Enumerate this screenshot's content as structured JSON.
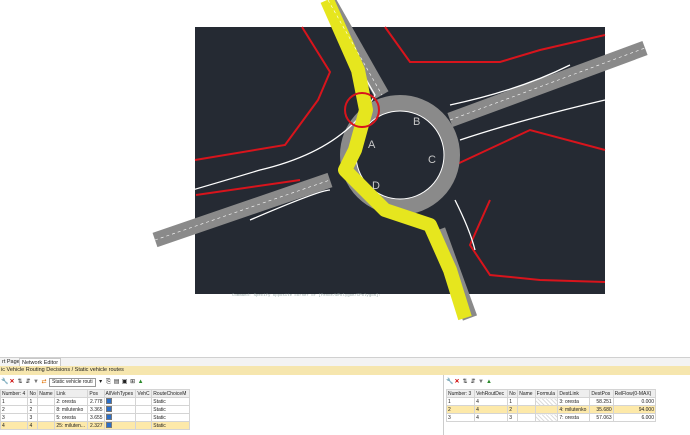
{
  "canvas": {
    "labels": [
      "A",
      "B",
      "C",
      "D"
    ],
    "command_line": "Command: Specify opposite corner or [Fence/WPolygon/CPolygon]:"
  },
  "tabs": [
    "rt Page",
    "Network Editor"
  ],
  "breadcrumb": "ic Vehicle Routing Decisions / Static vehicle routes",
  "left_toolbar": {
    "selector_value": "Static vehicle routi"
  },
  "left_table": {
    "columns": [
      "Number: 4",
      "No",
      "Name",
      "Link",
      "Pos",
      "AllVehTypes",
      "VehC",
      "RouteChoiceM"
    ],
    "rows": [
      [
        "1",
        "1",
        "",
        "2: oresta",
        "2.778",
        true,
        "",
        "Static"
      ],
      [
        "2",
        "2",
        "",
        "8: milutenko",
        "3.365",
        true,
        "",
        "Static"
      ],
      [
        "3",
        "3",
        "",
        "5: oresta",
        "3.655",
        true,
        "",
        "Static"
      ],
      [
        "4",
        "4",
        "",
        "25: miluten...",
        "2.327",
        true,
        "",
        "Static"
      ]
    ],
    "selected_row": 3
  },
  "right_table": {
    "columns": [
      "Number: 3",
      "VehRoutDec",
      "No",
      "Name",
      "Formula",
      "DestLink",
      "DestPos",
      "RelFlow(0-MAX)"
    ],
    "rows": [
      [
        "1",
        "4",
        "1",
        "",
        "",
        "3: oresta",
        "58.251",
        "0.000"
      ],
      [
        "2",
        "4",
        "2",
        "",
        "",
        "4: milutenko",
        "35.680",
        "94.000"
      ],
      [
        "3",
        "4",
        "3",
        "",
        "",
        "7: oresta",
        "57.063",
        "6.000"
      ]
    ],
    "selected_row": 1
  },
  "colors": {
    "cad_background": "#252a33",
    "road": "#8a8a8a",
    "route_highlight": "#e6e61e",
    "boundary_red": "#d8141c",
    "curb_white": "#ffffff",
    "selection_row": "#fde9a9",
    "path_bar": "#f6e6ae"
  }
}
